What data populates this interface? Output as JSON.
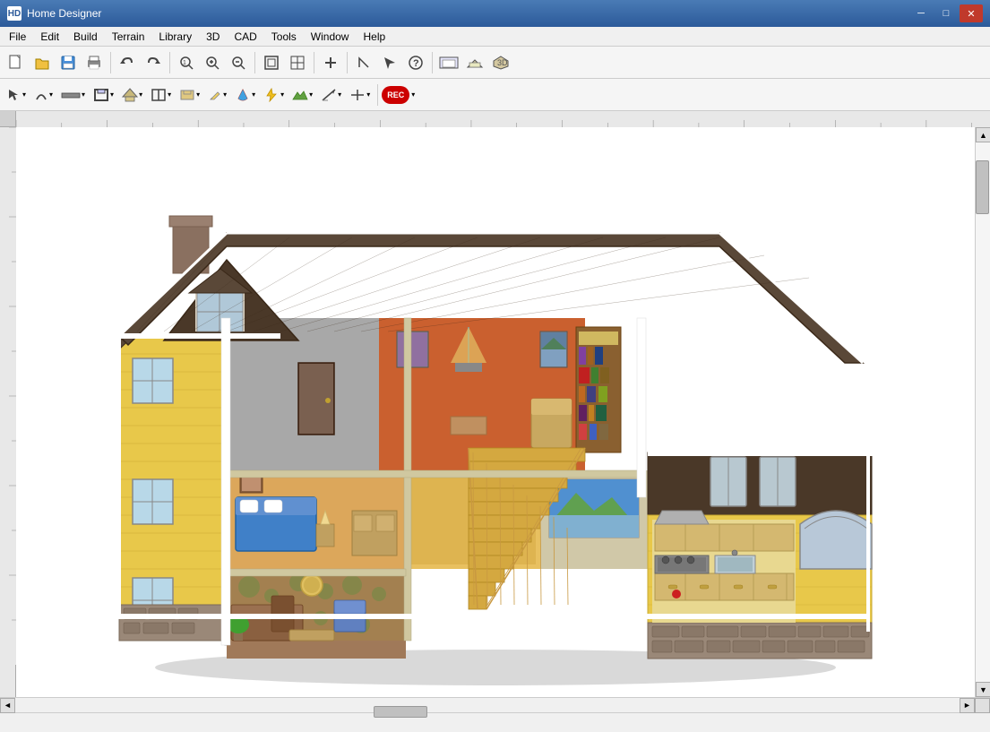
{
  "window": {
    "title": "Home Designer",
    "icon": "HD"
  },
  "title_bar": {
    "minimize": "─",
    "maximize": "□",
    "close": "✕"
  },
  "menu": {
    "items": [
      "File",
      "Edit",
      "Build",
      "Terrain",
      "Library",
      "3D",
      "CAD",
      "Tools",
      "Window",
      "Help"
    ]
  },
  "toolbar1": {
    "buttons": [
      {
        "icon": "📄",
        "name": "new"
      },
      {
        "icon": "📂",
        "name": "open"
      },
      {
        "icon": "💾",
        "name": "save"
      },
      {
        "icon": "🖨",
        "name": "print"
      },
      {
        "sep": true
      },
      {
        "icon": "↩",
        "name": "undo"
      },
      {
        "icon": "↪",
        "name": "redo"
      },
      {
        "sep": true
      },
      {
        "icon": "🔍",
        "name": "zoom-out-small"
      },
      {
        "icon": "🔎",
        "name": "zoom-in"
      },
      {
        "icon": "🔍",
        "name": "zoom-out"
      },
      {
        "sep": true
      },
      {
        "icon": "⊞",
        "name": "fit-window"
      },
      {
        "icon": "⊡",
        "name": "fit-page"
      },
      {
        "sep": true
      },
      {
        "icon": "+",
        "name": "add"
      },
      {
        "sep": true
      },
      {
        "icon": "△",
        "name": "roof"
      },
      {
        "icon": "➤",
        "name": "arrow-tool"
      },
      {
        "icon": "?",
        "name": "help"
      },
      {
        "sep": true
      },
      {
        "icon": "🏠",
        "name": "house-view"
      },
      {
        "icon": "🏡",
        "name": "house-3d"
      },
      {
        "icon": "🏘",
        "name": "house-full"
      }
    ]
  },
  "toolbar2": {
    "buttons": [
      {
        "icon": "↖",
        "name": "select",
        "dropdown": true
      },
      {
        "icon": "⌒",
        "name": "arc",
        "dropdown": true
      },
      {
        "icon": "━━",
        "name": "wall",
        "dropdown": true
      },
      {
        "icon": "▦",
        "name": "room",
        "dropdown": true
      },
      {
        "icon": "⌂",
        "name": "structure",
        "dropdown": true
      },
      {
        "icon": "☐",
        "name": "window-tool",
        "dropdown": true
      },
      {
        "icon": "⬜",
        "name": "cabinet",
        "dropdown": true
      },
      {
        "icon": "✏",
        "name": "pencil",
        "dropdown": true
      },
      {
        "icon": "🎨",
        "name": "paint",
        "dropdown": true
      },
      {
        "icon": "⚙",
        "name": "electric",
        "dropdown": true
      },
      {
        "icon": "⬡",
        "name": "terrain2",
        "dropdown": true
      },
      {
        "icon": "↑",
        "name": "dimension-up",
        "dropdown": true
      },
      {
        "icon": "✚",
        "name": "cross",
        "dropdown": true
      },
      {
        "icon": "REC",
        "name": "record",
        "special": true
      }
    ]
  },
  "house_image": {
    "alt": "3D house cutaway view showing interior rooms with furniture"
  },
  "status_bar": {
    "text": ""
  }
}
